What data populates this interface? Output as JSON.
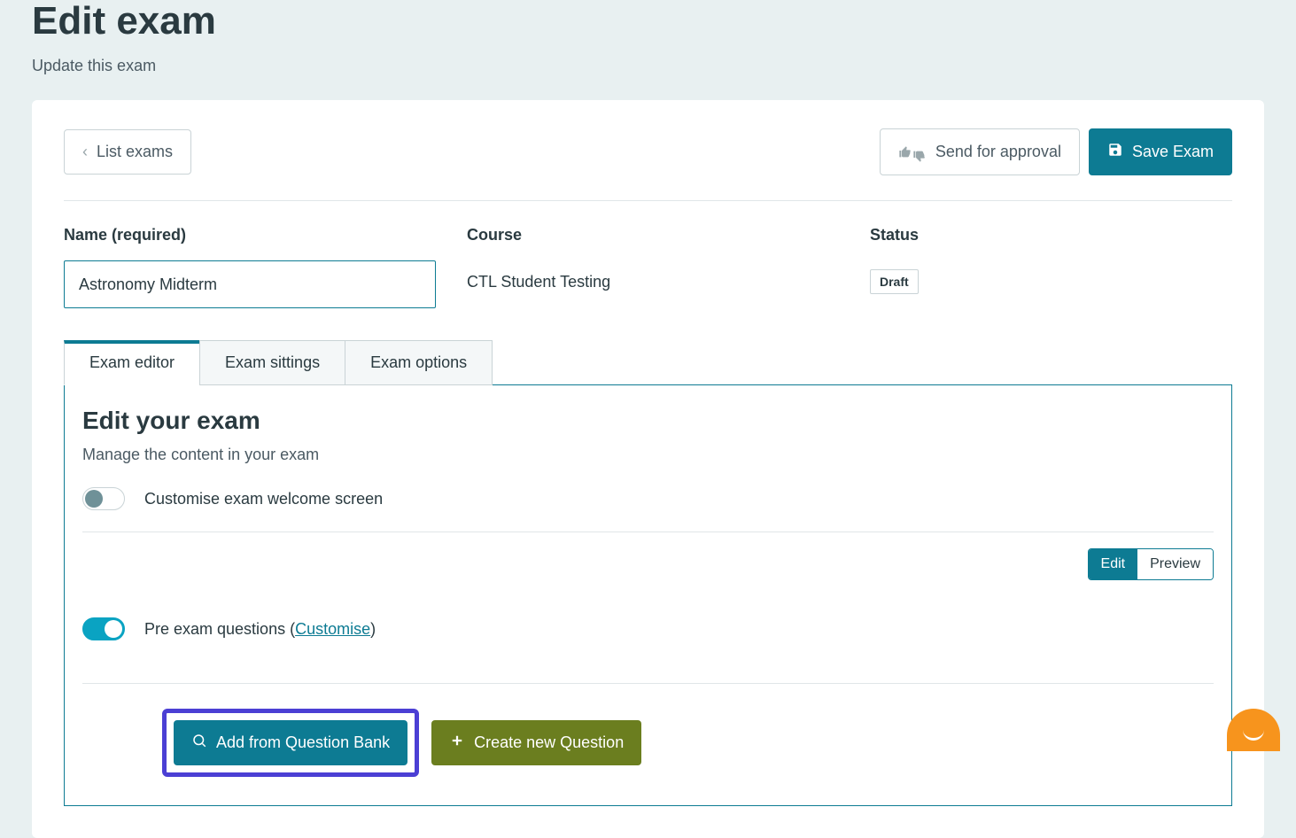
{
  "page": {
    "title": "Edit exam",
    "subtitle": "Update this exam"
  },
  "toolbar": {
    "list_exams_label": "List exams",
    "send_for_approval_label": "Send for approval",
    "save_exam_label": "Save Exam"
  },
  "meta": {
    "name_label": "Name (required)",
    "name_value": "Astronomy Midterm",
    "course_label": "Course",
    "course_value": "CTL Student Testing",
    "status_label": "Status",
    "status_value": "Draft"
  },
  "tabs": {
    "editor": "Exam editor",
    "sittings": "Exam sittings",
    "options": "Exam options"
  },
  "panel": {
    "title": "Edit your exam",
    "subtitle": "Manage the content in your exam",
    "customise_welcome_label": "Customise exam welcome screen",
    "pre_exam_prefix": "Pre exam questions (",
    "pre_exam_link": "Customise",
    "pre_exam_suffix": ")",
    "edit_label": "Edit",
    "preview_label": "Preview"
  },
  "actions": {
    "add_from_bank_label": "Add from Question Bank",
    "create_new_label": "Create new Question"
  }
}
